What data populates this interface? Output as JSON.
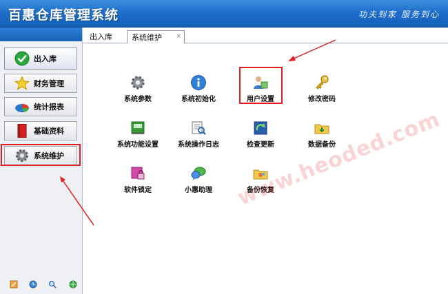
{
  "app": {
    "title": "百惠仓库管理系统",
    "slogan": "功夫到家 服务到心"
  },
  "sidebar": {
    "items": [
      {
        "label": "出入库",
        "icon": "check-icon",
        "active": true
      },
      {
        "label": "财务管理",
        "icon": "star-icon",
        "active": false
      },
      {
        "label": "统计报表",
        "icon": "pie-chart-icon",
        "active": false
      },
      {
        "label": "基础资料",
        "icon": "book-icon",
        "active": false
      },
      {
        "label": "系统维护",
        "icon": "gear-icon",
        "active": false
      }
    ],
    "bottom_icons": [
      "edit-icon",
      "clock-icon",
      "search-icon",
      "globe-icon"
    ]
  },
  "tabs": [
    {
      "label": "出入库"
    },
    {
      "label": "系统维护",
      "close": "×"
    }
  ],
  "tiles": [
    {
      "label": "系统参数",
      "icon": "gear-icon"
    },
    {
      "label": "系统初始化",
      "icon": "info-icon"
    },
    {
      "label": "用户设置",
      "icon": "user-settings-icon"
    },
    {
      "label": "修改密码",
      "icon": "key-icon"
    },
    {
      "label": "系统功能设置",
      "icon": "function-settings-icon"
    },
    {
      "label": "系统操作日志",
      "icon": "log-icon"
    },
    {
      "label": "检查更新",
      "icon": "update-icon"
    },
    {
      "label": "数据备份",
      "icon": "backup-folder-icon"
    },
    {
      "label": "软件锁定",
      "icon": "lock-icon"
    },
    {
      "label": "小惠助理",
      "icon": "chat-icon"
    },
    {
      "label": "备份恢复",
      "icon": "restore-folder-icon"
    }
  ],
  "watermark": "www.heoded.com",
  "colors": {
    "title_bar": "#1f6fca",
    "highlight": "#e02020"
  }
}
